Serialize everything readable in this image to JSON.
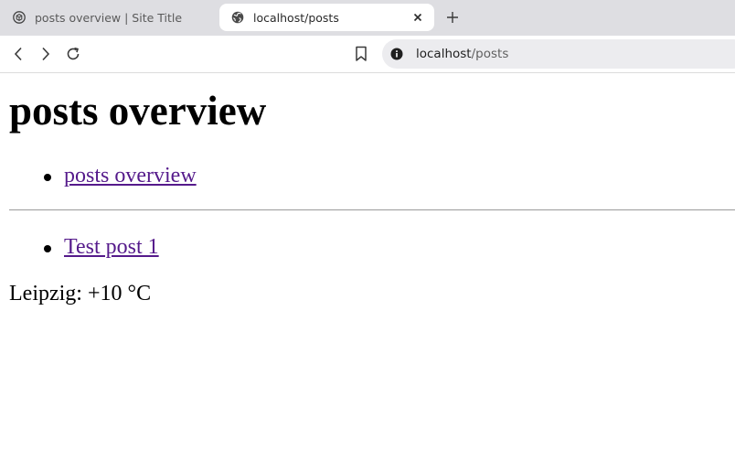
{
  "browser": {
    "tabs": [
      {
        "title": "posts overview | Site Title",
        "active": false
      },
      {
        "title": "localhost/posts",
        "active": true
      }
    ],
    "url": {
      "host": "localhost",
      "path": "/posts"
    }
  },
  "page": {
    "heading": "posts overview",
    "nav_links": [
      "posts overview"
    ],
    "posts": [
      "Test post 1"
    ],
    "weather": "Leipzig: +10 °C"
  },
  "colors": {
    "link_visited": "#551a8b",
    "tabstrip_bg": "#dedee2",
    "urlbar_bg": "#ececef"
  }
}
